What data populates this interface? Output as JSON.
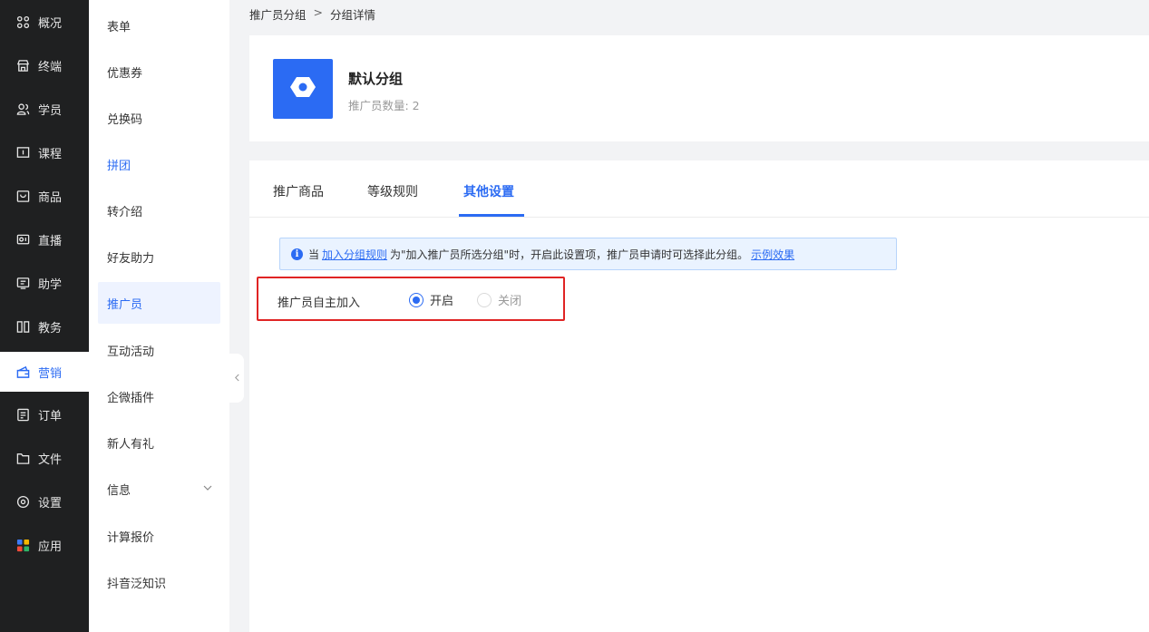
{
  "nav": {
    "items": [
      {
        "label": "概况",
        "icon": "grid-icon"
      },
      {
        "label": "终端",
        "icon": "store-icon"
      },
      {
        "label": "学员",
        "icon": "users-icon"
      },
      {
        "label": "课程",
        "icon": "course-icon"
      },
      {
        "label": "商品",
        "icon": "goods-icon"
      },
      {
        "label": "直播",
        "icon": "live-icon"
      },
      {
        "label": "助学",
        "icon": "study-icon"
      },
      {
        "label": "教务",
        "icon": "affairs-icon"
      },
      {
        "label": "营销",
        "icon": "marketing-icon"
      },
      {
        "label": "订单",
        "icon": "order-icon"
      },
      {
        "label": "文件",
        "icon": "folder-icon"
      },
      {
        "label": "设置",
        "icon": "settings-icon"
      },
      {
        "label": "应用",
        "icon": "apps-icon"
      }
    ],
    "active_index": 8
  },
  "sub_menu": {
    "items": [
      {
        "label": "表单"
      },
      {
        "label": "优惠券"
      },
      {
        "label": "兑换码"
      },
      {
        "label": "拼团"
      },
      {
        "label": "转介绍"
      },
      {
        "label": "好友助力"
      },
      {
        "label": "推广员"
      },
      {
        "label": "互动活动"
      },
      {
        "label": "企微插件"
      },
      {
        "label": "新人有礼"
      },
      {
        "label": "信息"
      },
      {
        "label": "计算报价"
      },
      {
        "label": "抖音泛知识"
      }
    ],
    "active_index": 6,
    "highlight_index": 3
  },
  "breadcrumb": {
    "parent": "推广员分组",
    "separator": ">",
    "current": "分组详情"
  },
  "group": {
    "name": "默认分组",
    "count_label": "推广员数量: 2"
  },
  "tabs": [
    {
      "label": "推广商品"
    },
    {
      "label": "等级规则"
    },
    {
      "label": "其他设置"
    }
  ],
  "active_tab": 2,
  "notice": {
    "prefix": "当",
    "link1": "加入分组规则",
    "middle": "为\"加入推广员所选分组\"时，开启此设置项，推广员申请时可选择此分组。",
    "link2": "示例效果"
  },
  "setting": {
    "label": "推广员自主加入",
    "options": [
      "开启",
      "关闭"
    ],
    "selected": "开启"
  },
  "colors": {
    "accent": "#2b6bf3",
    "nav_bg": "#1f2021",
    "highlight_border": "#e02424"
  }
}
